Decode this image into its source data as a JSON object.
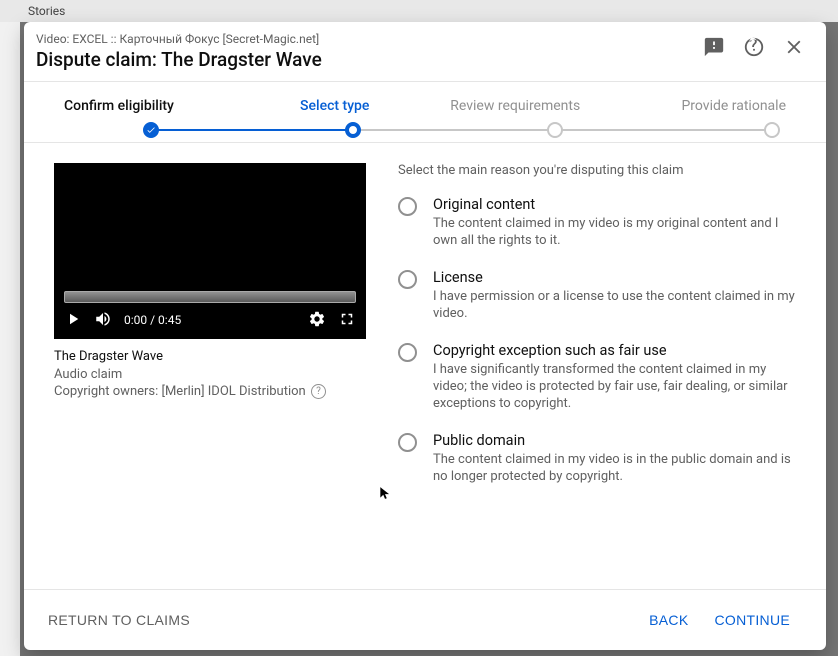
{
  "background": {
    "stories_label": "Stories"
  },
  "header": {
    "video_label": "Video: EXCEL :: Карточный Фокус [Secret-Magic.net]",
    "title": "Dispute claim: The Dragster Wave",
    "feedback_icon": "feedback-icon",
    "help_icon": "help-icon",
    "close_icon": "close-icon"
  },
  "stepper": {
    "steps": [
      {
        "label": "Confirm eligibility",
        "state": "complete"
      },
      {
        "label": "Select type",
        "state": "active"
      },
      {
        "label": "Review requirements",
        "state": "future"
      },
      {
        "label": "Provide rationale",
        "state": "future"
      }
    ]
  },
  "player": {
    "current_time": "0:00",
    "duration": "0:45",
    "time_text": "0:00 / 0:45"
  },
  "video_info": {
    "title": "The Dragster Wave",
    "claim_type": "Audio claim",
    "owners_label": "Copyright owners: [Merlin] IDOL Distribution"
  },
  "right": {
    "section_label": "Select the main reason you're disputing this claim",
    "options": [
      {
        "title": "Original content",
        "desc": "The content claimed in my video is my original content and I own all the rights to it."
      },
      {
        "title": "License",
        "desc": "I have permission or a license to use the content claimed in my video."
      },
      {
        "title": "Copyright exception such as fair use",
        "desc": "I have significantly transformed the content claimed in my video; the video is protected by fair use, fair dealing, or similar exceptions to copyright."
      },
      {
        "title": "Public domain",
        "desc": "The content claimed in my video is in the public domain and is no longer protected by copyright."
      }
    ]
  },
  "footer": {
    "return_label": "RETURN TO CLAIMS",
    "back_label": "BACK",
    "continue_label": "CONTINUE"
  }
}
